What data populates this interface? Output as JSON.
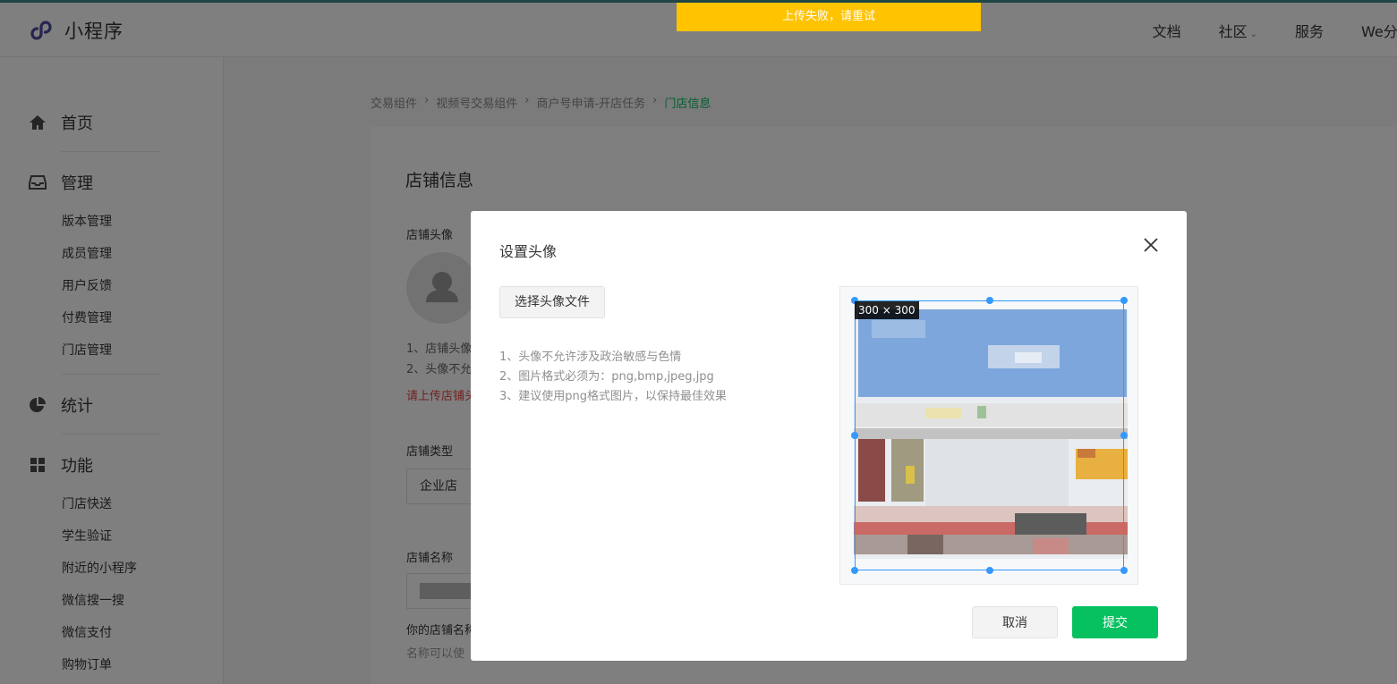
{
  "header": {
    "logo_text": "小程序",
    "nav": [
      {
        "label": "文档"
      },
      {
        "label": "社区",
        "has_dropdown": true
      },
      {
        "label": "服务"
      },
      {
        "label": "We分"
      }
    ]
  },
  "toast": {
    "text": "上传失败，请重试",
    "color": "#ffc300"
  },
  "sidebar": {
    "sections": [
      {
        "label": "首页",
        "icon": "home-icon",
        "items": []
      },
      {
        "label": "管理",
        "icon": "inbox-icon",
        "items": [
          "版本管理",
          "成员管理",
          "用户反馈",
          "付费管理",
          "门店管理"
        ]
      },
      {
        "label": "统计",
        "icon": "pie-chart-icon",
        "items": []
      },
      {
        "label": "功能",
        "icon": "grid-icon",
        "items": [
          "门店快送",
          "学生验证",
          "附近的小程序",
          "微信搜一搜",
          "微信支付",
          "购物订单"
        ]
      }
    ]
  },
  "breadcrumb": [
    "交易组件",
    "视频号交易组件",
    "商户号申请-开店任务",
    "门店信息"
  ],
  "page": {
    "title": "店铺信息",
    "avatar_label": "店铺头像",
    "avatar_notes": [
      "1、店铺头像",
      "2、头像不允"
    ],
    "avatar_error": "请上传店铺头",
    "type_label": "店铺类型",
    "type_value": "企业店",
    "name_label": "店铺名称",
    "name_hint_1": "你的店铺名称",
    "name_hint_2": "名称可以使"
  },
  "modal": {
    "title": "设置头像",
    "choose_button": "选择头像文件",
    "tips": [
      "1、头像不允许涉及政治敏感与色情",
      "2、图片格式必须为：png,bmp,jpeg,jpg",
      "3、建议使用png格式图片，以保持最佳效果"
    ],
    "crop_size": "300 × 300",
    "cancel_label": "取消",
    "submit_label": "提交"
  },
  "colors": {
    "accent": "#07c160",
    "selection": "#3399ff",
    "error": "#e64340"
  }
}
